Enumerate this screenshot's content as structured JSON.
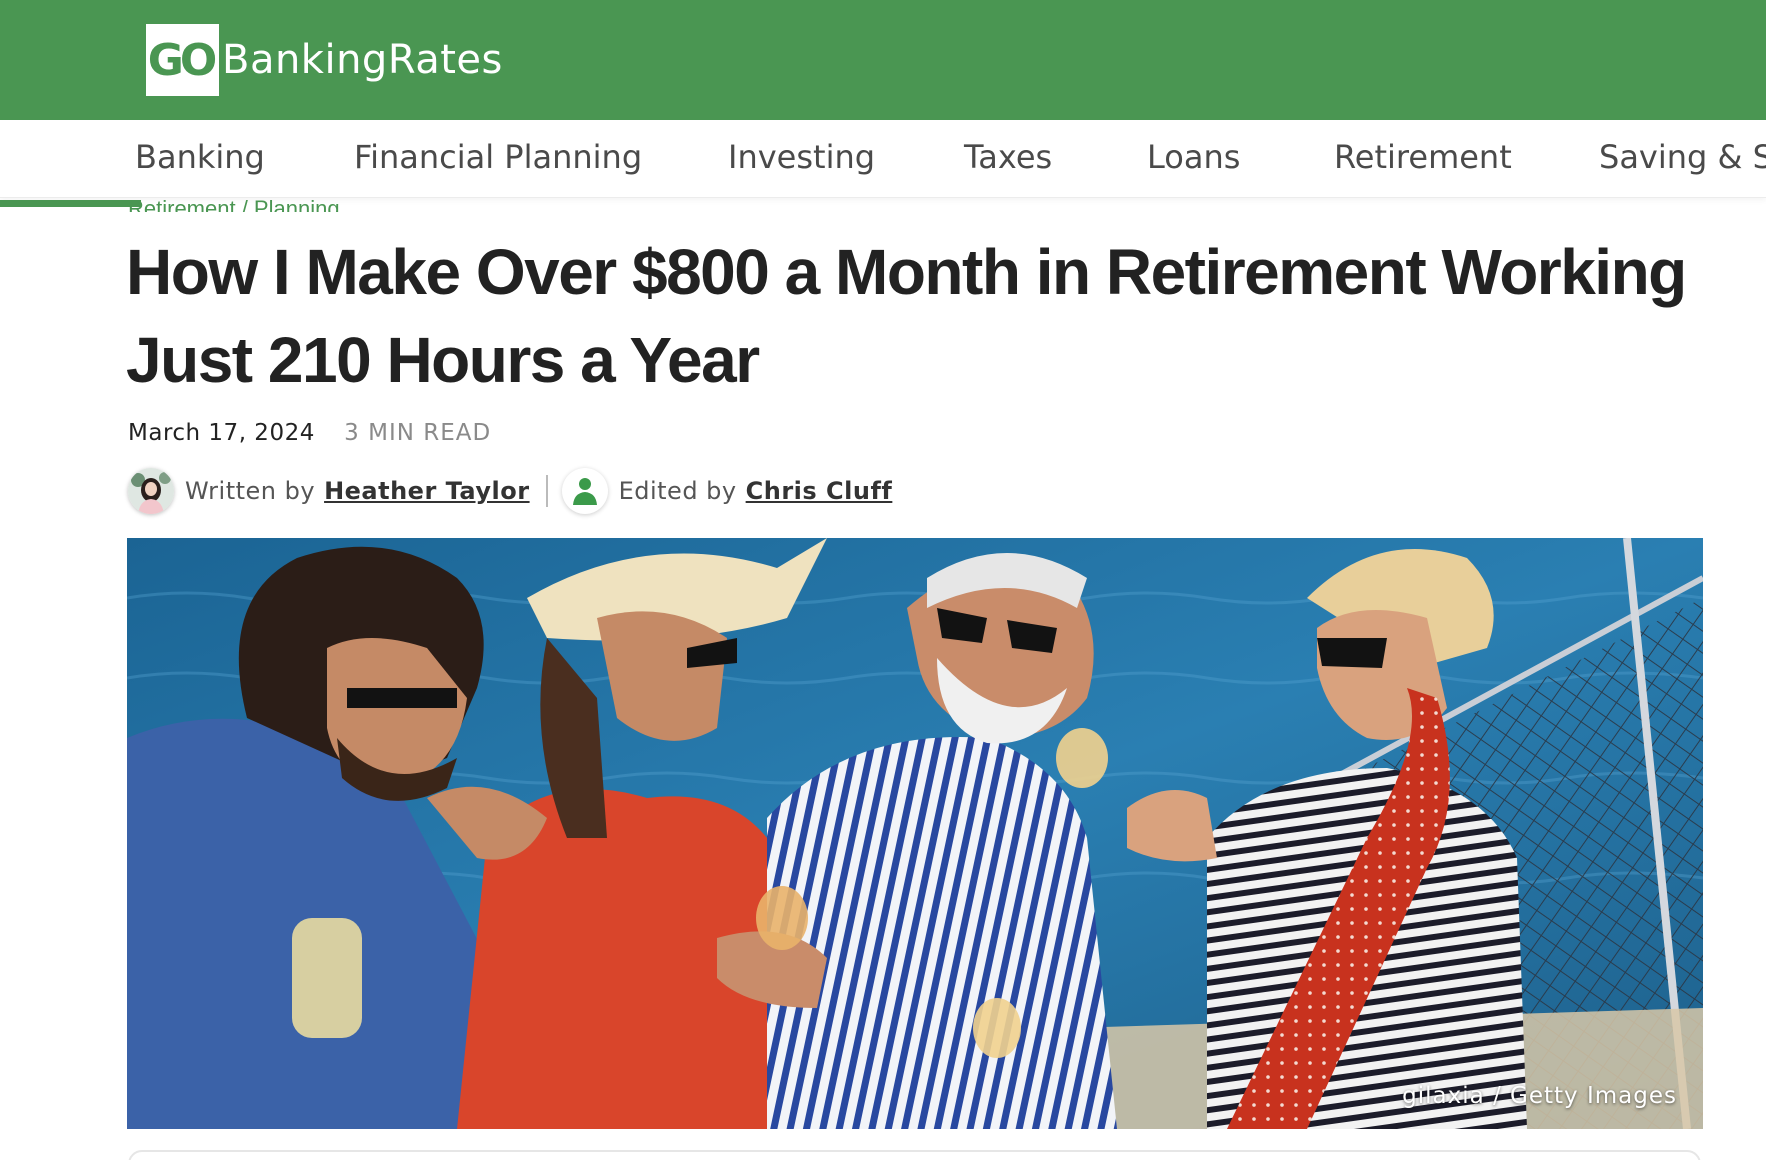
{
  "header": {
    "logo_mark": "GO",
    "logo_text": "BankingRates",
    "brand_color": "#4a9652"
  },
  "nav": {
    "items": [
      {
        "label": "Banking"
      },
      {
        "label": "Financial Planning"
      },
      {
        "label": "Investing"
      },
      {
        "label": "Taxes"
      },
      {
        "label": "Loans"
      },
      {
        "label": "Retirement"
      },
      {
        "label": "Saving & S"
      }
    ],
    "scroll_progress_percent": 8
  },
  "breadcrumb": "Retirement / Planning",
  "article": {
    "title": "How I Make Over $800 a Month in Retirement Working Just 210 Hours a Year",
    "date": "March 17, 2024",
    "read_time": "3 MIN READ",
    "written_by_label": "Written by",
    "author": "Heather Taylor",
    "edited_by_label": "Edited by",
    "editor": "Chris Cluff",
    "image_credit": "gilaxia / Getty Images"
  }
}
